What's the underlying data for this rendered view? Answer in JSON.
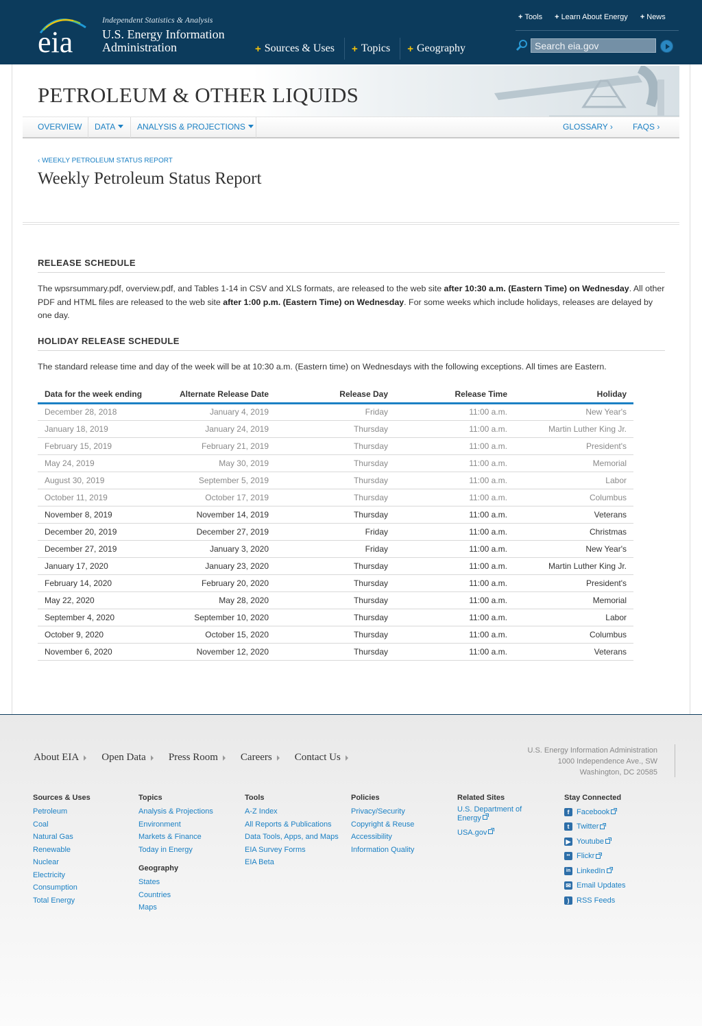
{
  "header": {
    "tagline": "Independent Statistics & Analysis",
    "org_line1": "U.S. Energy Information",
    "org_line2": "Administration",
    "logo_text": "eia",
    "main_nav": [
      "Sources & Uses",
      "Topics",
      "Geography"
    ],
    "util_nav": [
      "Tools",
      "Learn About Energy",
      "News"
    ],
    "search_placeholder": "Search eia.gov",
    "brand_color": "#0c3b5c",
    "accent_color": "#f2c20e"
  },
  "banner": {
    "title": "PETROLEUM & OTHER LIQUIDS"
  },
  "subnav": {
    "overview": "OVERVIEW",
    "data": "DATA",
    "analysis": "ANALYSIS & PROJECTIONS",
    "glossary": "GLOSSARY ›",
    "faqs": "FAQS ›"
  },
  "breadcrumb": "‹ WEEKLY PETROLEUM STATUS REPORT",
  "page_title": "Weekly Petroleum Status Report",
  "release_schedule": {
    "heading": "RELEASE SCHEDULE",
    "p_part1": "The wpsrsummary.pdf, overview.pdf, and Tables 1-14 in CSV and XLS formats, are released to the web site ",
    "p_bold1": "after 10:30 a.m. (Eastern Time) on Wednesday",
    "p_part2": ". All other PDF and HTML files are released to the web site ",
    "p_bold2": "after 1:00 p.m. (Eastern Time) on Wednesday",
    "p_part3": ". For some weeks which include holidays, releases are delayed by one day."
  },
  "holiday_schedule": {
    "heading": "HOLIDAY RELEASE SCHEDULE",
    "intro": "The standard release time and day of the week will be at 10:30 a.m. (Eastern time) on Wednesdays with the following exceptions. All times are Eastern.",
    "columns": [
      "Data for the week ending",
      "Alternate Release Date",
      "Release Day",
      "Release Time",
      "Holiday"
    ],
    "rows": [
      {
        "week": "December 28, 2018",
        "alt": "January 4, 2019",
        "day": "Friday",
        "time": "11:00 a.m.",
        "holiday": "New Year's",
        "past": true
      },
      {
        "week": "January 18, 2019",
        "alt": "January 24, 2019",
        "day": "Thursday",
        "time": "11:00 a.m.",
        "holiday": "Martin Luther King Jr.",
        "past": true
      },
      {
        "week": "February 15, 2019",
        "alt": "February 21, 2019",
        "day": "Thursday",
        "time": "11:00 a.m.",
        "holiday": "President's",
        "past": true
      },
      {
        "week": "May 24, 2019",
        "alt": "May 30, 2019",
        "day": "Thursday",
        "time": "11:00 a.m.",
        "holiday": "Memorial",
        "past": true
      },
      {
        "week": "August 30, 2019",
        "alt": "September 5, 2019",
        "day": "Thursday",
        "time": "11:00 a.m.",
        "holiday": "Labor",
        "past": true
      },
      {
        "week": "October 11, 2019",
        "alt": "October 17, 2019",
        "day": "Thursday",
        "time": "11:00 a.m.",
        "holiday": "Columbus",
        "past": true
      },
      {
        "week": "November 8, 2019",
        "alt": "November 14, 2019",
        "day": "Thursday",
        "time": "11:00 a.m.",
        "holiday": "Veterans",
        "past": false
      },
      {
        "week": "December 20, 2019",
        "alt": "December 27, 2019",
        "day": "Friday",
        "time": "11:00 a.m.",
        "holiday": "Christmas",
        "past": false
      },
      {
        "week": "December 27, 2019",
        "alt": "January 3, 2020",
        "day": "Friday",
        "time": "11:00 a.m.",
        "holiday": "New Year's",
        "past": false
      },
      {
        "week": "January 17, 2020",
        "alt": "January 23, 2020",
        "day": "Thursday",
        "time": "11:00 a.m.",
        "holiday": "Martin Luther King Jr.",
        "past": false
      },
      {
        "week": "February 14, 2020",
        "alt": "February 20, 2020",
        "day": "Thursday",
        "time": "11:00 a.m.",
        "holiday": "President's",
        "past": false
      },
      {
        "week": "May 22, 2020",
        "alt": "May 28, 2020",
        "day": "Thursday",
        "time": "11:00 a.m.",
        "holiday": "Memorial",
        "past": false
      },
      {
        "week": "September 4, 2020",
        "alt": "September 10, 2020",
        "day": "Thursday",
        "time": "11:00 a.m.",
        "holiday": "Labor",
        "past": false
      },
      {
        "week": "October 9, 2020",
        "alt": "October 15, 2020",
        "day": "Thursday",
        "time": "11:00 a.m.",
        "holiday": "Columbus",
        "past": false
      },
      {
        "week": "November 6, 2020",
        "alt": "November 12, 2020",
        "day": "Thursday",
        "time": "11:00 a.m.",
        "holiday": "Veterans",
        "past": false
      }
    ]
  },
  "footer": {
    "links": [
      "About EIA",
      "Open Data",
      "Press Room",
      "Careers",
      "Contact Us"
    ],
    "address": [
      "U.S. Energy Information Administration",
      "1000 Independence Ave., SW",
      "Washington, DC 20585"
    ],
    "columns": {
      "sources": {
        "title": "Sources & Uses",
        "items": [
          "Petroleum",
          "Coal",
          "Natural Gas",
          "Renewable",
          "Nuclear",
          "Electricity",
          "Consumption",
          "Total Energy"
        ]
      },
      "topics": {
        "title": "Topics",
        "items": [
          "Analysis & Projections",
          "Environment",
          "Markets & Finance",
          "Today in Energy"
        ]
      },
      "geography": {
        "title": "Geography",
        "items": [
          "States",
          "Countries",
          "Maps"
        ]
      },
      "tools": {
        "title": "Tools",
        "items": [
          "A-Z Index",
          "All Reports & Publications",
          "Data Tools, Apps, and Maps",
          "EIA Survey Forms",
          "EIA Beta"
        ]
      },
      "policies": {
        "title": "Policies",
        "items": [
          "Privacy/Security",
          "Copyright & Reuse",
          "Accessibility",
          "Information Quality"
        ]
      },
      "related": {
        "title": "Related Sites",
        "items": [
          "U.S. Department of Energy",
          "USA.gov"
        ]
      },
      "connected": {
        "title": "Stay Connected",
        "items": [
          {
            "label": "Facebook",
            "icon": "facebook-icon"
          },
          {
            "label": "Twitter",
            "icon": "twitter-icon"
          },
          {
            "label": "Youtube",
            "icon": "youtube-icon"
          },
          {
            "label": "Flickr",
            "icon": "flickr-icon"
          },
          {
            "label": "LinkedIn",
            "icon": "linkedin-icon"
          },
          {
            "label": "Email Updates",
            "icon": "email-icon"
          },
          {
            "label": "RSS Feeds",
            "icon": "rss-icon"
          }
        ]
      }
    }
  }
}
